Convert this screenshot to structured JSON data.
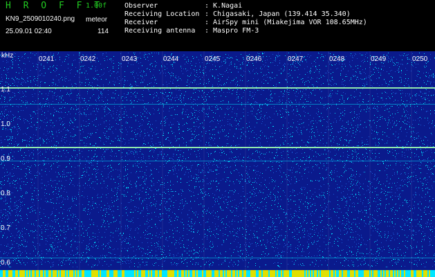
{
  "header": {
    "app_title": "H R O F F T",
    "version": "1.00f",
    "filename": "KN9_2509010240.png",
    "mode": "meteor",
    "datetime": "25.09.01 02:40",
    "count": "114",
    "info": [
      {
        "label": "Observer",
        "value": ": K.Nagai"
      },
      {
        "label": "Receiving Location",
        "value": ": Chigasaki, Japan (139.414 35.340)"
      },
      {
        "label": "Receiver",
        "value": ": AirSpy mini (Miakejima VOR 108.65MHz)"
      },
      {
        "label": "Receiving antenna",
        "value": ": Maspro FM-3"
      }
    ]
  },
  "spectrogram": {
    "y_unit": "kHz",
    "y_ticks": [
      "1.1",
      "1.0",
      "0.9",
      "0.8",
      "0.7",
      "0.6"
    ],
    "time_ticks": [
      "0241",
      "0242",
      "0243",
      "0244",
      "0245",
      "0246",
      "0247",
      "0248",
      "0249",
      "0250"
    ],
    "colors": {
      "background": "#0a1a8c",
      "noise_high": "#00e5ff",
      "noise_mid": "#1a5cd6",
      "signal": "#a0ffb0",
      "bottom_bar": "#e0e000"
    }
  }
}
